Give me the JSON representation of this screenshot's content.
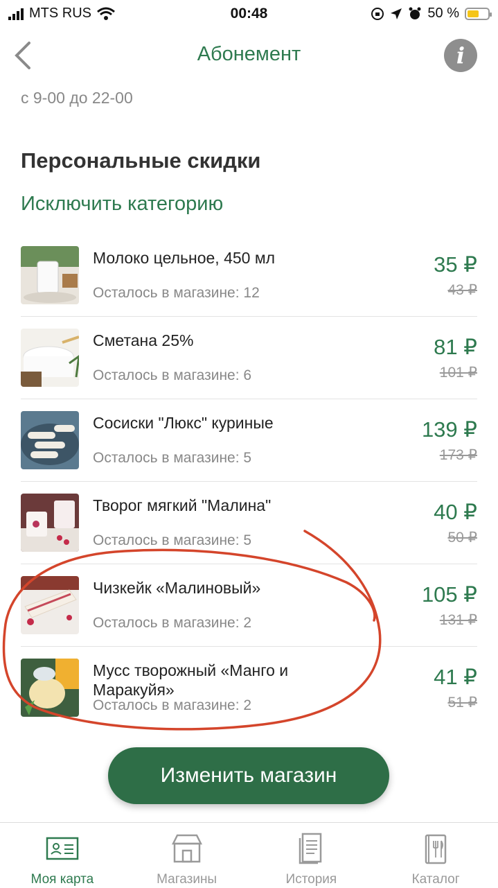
{
  "status_bar": {
    "carrier": "MTS RUS",
    "time": "00:48",
    "battery": "50 %"
  },
  "nav": {
    "title": "Абонемент",
    "back_icon": "chevron-left-icon",
    "info_icon": "info-icon"
  },
  "hours": "с 9-00 до 22-00",
  "section_title": "Персональные скидки",
  "exclude_link": "Исключить категорию",
  "products": [
    {
      "name": "Молоко цельное, 450 мл",
      "stock": "Осталось в магазине: 12",
      "price": "35 ₽",
      "old_price": "43 ₽"
    },
    {
      "name": "Сметана 25%",
      "stock": "Осталось в магазине: 6",
      "price": "81 ₽",
      "old_price": "101 ₽"
    },
    {
      "name": "Сосиски \"Люкс\" куриные",
      "stock": "Осталось в магазине: 5",
      "price": "139 ₽",
      "old_price": "173 ₽"
    },
    {
      "name": "Творог мягкий \"Малина\"",
      "stock": "Осталось в магазине: 5",
      "price": "40 ₽",
      "old_price": "50 ₽"
    },
    {
      "name": "Чизкейк «Малиновый»",
      "stock": "Осталось в магазине: 2",
      "price": "105 ₽",
      "old_price": "131 ₽"
    },
    {
      "name": "Мусс творожный «Манго и Маракуйя»",
      "stock": "Осталось в магазине: 2",
      "price": "41 ₽",
      "old_price": "51 ₽"
    }
  ],
  "cta_label": "Изменить магазин",
  "tabs": [
    {
      "label": "Моя карта",
      "icon": "card-icon",
      "active": true
    },
    {
      "label": "Магазины",
      "icon": "store-icon",
      "active": false
    },
    {
      "label": "История",
      "icon": "receipt-icon",
      "active": false
    },
    {
      "label": "Каталог",
      "icon": "catalog-icon",
      "active": false
    }
  ],
  "colors": {
    "accent": "#2e7a4f",
    "button": "#2e6e47",
    "annotation": "#d4452b"
  }
}
